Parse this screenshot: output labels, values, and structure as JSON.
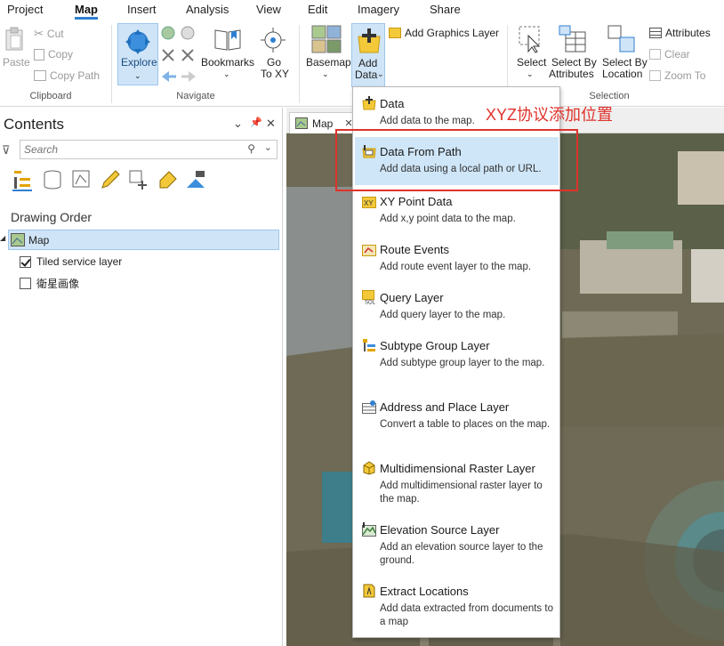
{
  "ribbon_tabs": [
    "Project",
    "Map",
    "Insert",
    "Analysis",
    "View",
    "Edit",
    "Imagery",
    "Share"
  ],
  "active_tab": "Map",
  "clipboard": {
    "paste": "Paste",
    "cut": "Cut",
    "copy": "Copy",
    "copy_path": "Copy Path",
    "group_label": "Clipboard"
  },
  "navigate": {
    "explore": "Explore",
    "bookmarks": "Bookmarks",
    "goto_line1": "Go",
    "goto_line2": "To XY",
    "group_label": "Navigate"
  },
  "layer": {
    "basemap": "Basemap",
    "add_data_line1": "Add",
    "add_data_line2": "Data",
    "add_graphics_layer": "Add Graphics Layer"
  },
  "selection": {
    "select": "Select",
    "select_by_attributes_1": "Select By",
    "select_by_attributes_2": "Attributes",
    "select_by_location_1": "Select By",
    "select_by_location_2": "Location",
    "attributes": "Attributes",
    "clear": "Clear",
    "zoom_to": "Zoom To",
    "group_label": "Selection"
  },
  "contents": {
    "title": "Contents",
    "search_placeholder": "Search",
    "section_title": "Drawing Order",
    "map_name": "Map",
    "layers": [
      {
        "name": "Tiled service layer",
        "checked": true
      },
      {
        "name": "衛星画像",
        "checked": false
      }
    ]
  },
  "map_view": {
    "tab_label": "Map"
  },
  "add_data_menu": [
    {
      "title": "Data",
      "desc": "Add data to the map."
    },
    {
      "title": "Data From Path",
      "desc": "Add data using a local path or URL."
    },
    {
      "title": "XY Point Data",
      "desc": "Add x,y point data to the map."
    },
    {
      "title": "Route Events",
      "desc": "Add route event layer to the map."
    },
    {
      "title": "Query Layer",
      "desc": "Add query layer to the map."
    },
    {
      "title": "Subtype Group Layer",
      "desc": "Add subtype group layer to the map."
    },
    {
      "title": "Address and Place Layer",
      "desc": "Convert a table to places on the map."
    },
    {
      "title": "Multidimensional Raster Layer",
      "desc": "Add multidimensional raster layer to the map."
    },
    {
      "title": "Elevation Source Layer",
      "desc": "Add an elevation source layer to the ground."
    },
    {
      "title": "Extract Locations",
      "desc": "Add data extracted from documents to a map"
    }
  ],
  "annotation": "XYZ协议添加位置",
  "colors": {
    "accent": "#2f7fd1",
    "highlight": "#cfe6f8",
    "annotation": "#e0322b"
  }
}
